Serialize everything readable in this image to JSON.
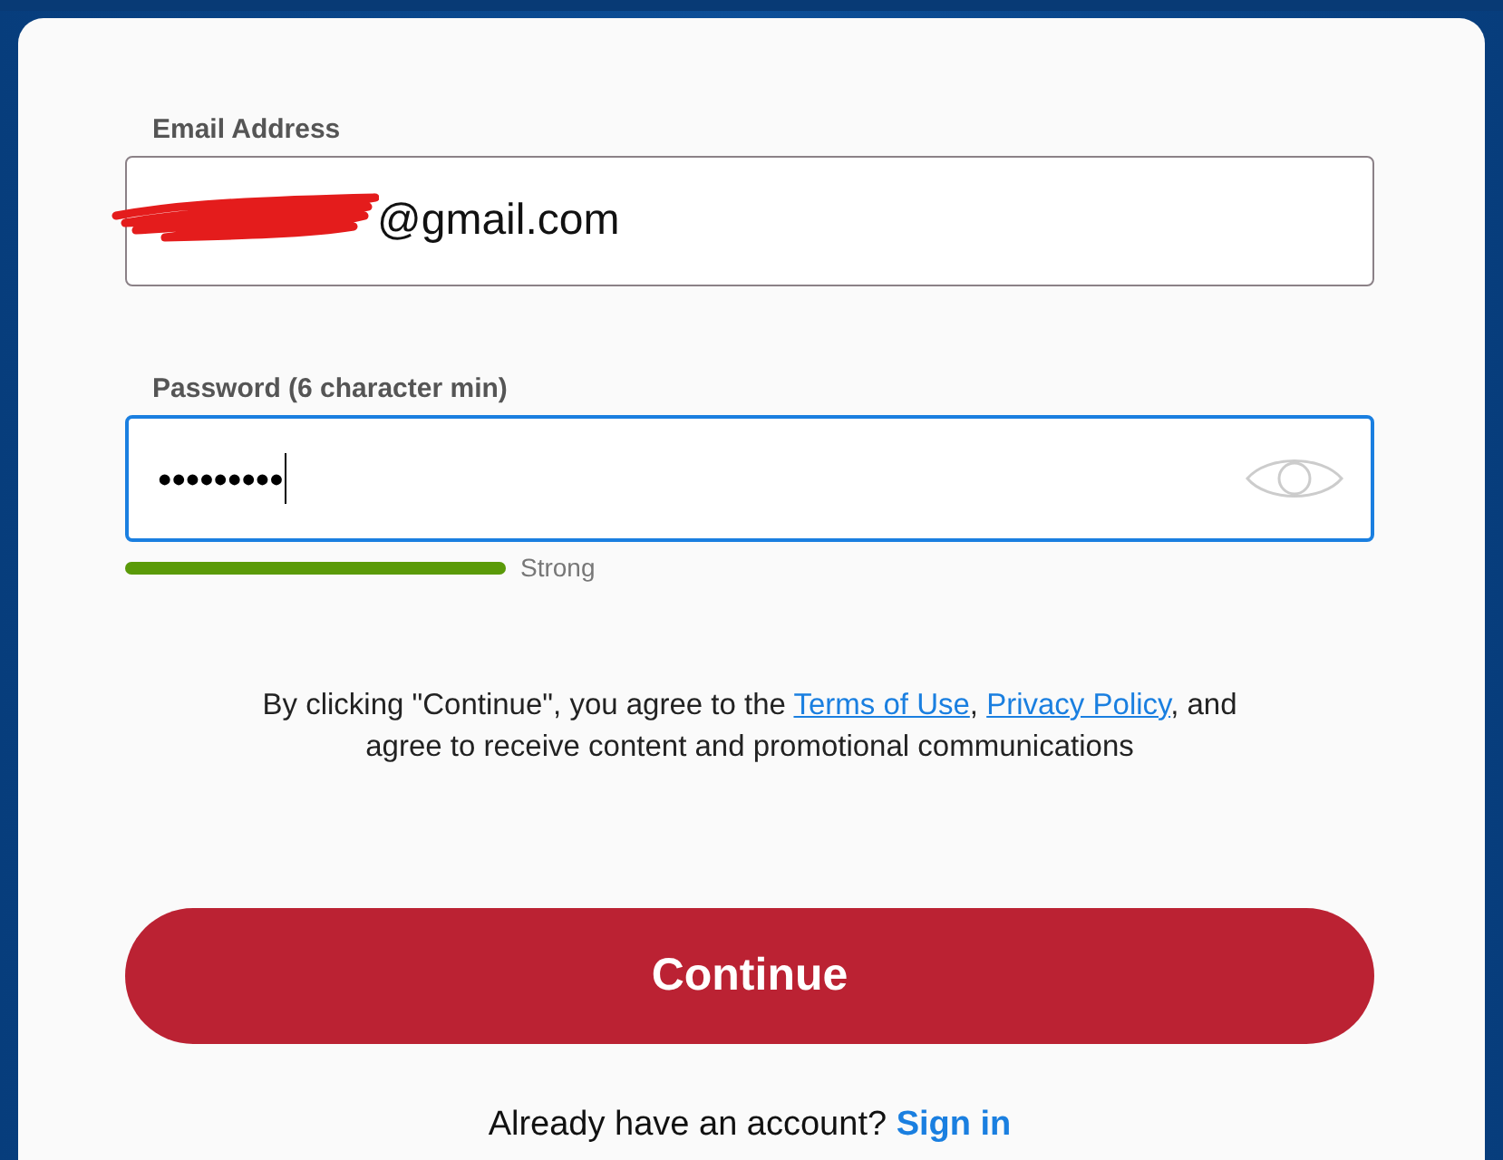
{
  "email_field": {
    "label": "Email Address",
    "value": "@gmail.com",
    "redacted": true,
    "focused": false
  },
  "password_field": {
    "label": "Password (6 character min)",
    "value": "•••••••••",
    "focused": true
  },
  "strength_meter": {
    "level": 1,
    "label": "Strong"
  },
  "consent": [
    {
      "kind": "text",
      "text": "By clicking \"Continue\", you agree to the "
    },
    {
      "kind": "link",
      "text": "Terms of Use"
    },
    {
      "kind": "text",
      "text": ", "
    },
    {
      "kind": "link",
      "text": "Privacy Policy"
    },
    {
      "kind": "text",
      "text": ", and"
    },
    {
      "kind": "break"
    },
    {
      "kind": "text",
      "text": "agree to receive content and promotional communications"
    }
  ],
  "continue_button": {
    "label": "Continue"
  },
  "signin": {
    "text": "Already have an account?",
    "link": "Sign in"
  }
}
